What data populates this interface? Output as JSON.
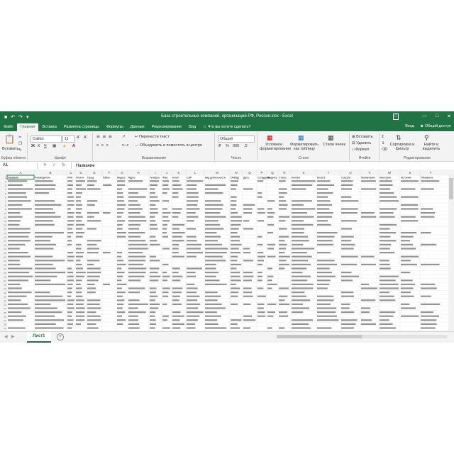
{
  "window": {
    "title": "База строительных компаний, организаций РФ, Россия.xlsx - Excel",
    "account_label": "Вход",
    "share_label": "Общий доступ",
    "tell_me": "Что вы хотите сделать?"
  },
  "tabs": [
    "Файл",
    "Главная",
    "Вставка",
    "Разметка страницы",
    "Формулы",
    "Данные",
    "Рецензирование",
    "Вид"
  ],
  "active_tab": "Главная",
  "ribbon": {
    "clipboard": {
      "paste": "Вставить",
      "label": "Буфер обмена"
    },
    "font": {
      "name": "Calibri",
      "size": "11",
      "label": "Шрифт"
    },
    "alignment": {
      "wrap": "Перенести текст",
      "merge": "Объединить и поместить в центре",
      "label": "Выравнивание"
    },
    "number": {
      "format": "Общий",
      "label": "Число"
    },
    "styles": {
      "conditional": "Условное форматирование",
      "format_table": "Форматировать как таблицу",
      "cell_styles": "Стили ячеек",
      "label": "Стили"
    },
    "cells": {
      "insert": "Вставить",
      "delete": "Удалить",
      "format": "Формат",
      "label": "Ячейки"
    },
    "editing": {
      "sort": "Сортировка и фильтр",
      "find": "Найти и выделить",
      "label": "Редактирование"
    }
  },
  "formula_bar": {
    "cell_ref": "A1",
    "value": "Название"
  },
  "columns": [
    "A",
    "B",
    "C",
    "D",
    "E",
    "F",
    "G",
    "H",
    "I",
    "J",
    "K",
    "L",
    "M",
    "N",
    "O",
    "P",
    "Q",
    "R",
    "S",
    "T",
    "U",
    "V",
    "W",
    "X",
    "Y"
  ],
  "headers": [
    "Название",
    "Руководитель",
    "ИНН",
    "Регион",
    "Город",
    "Район",
    "Индекс",
    "Адрес",
    "Телефон",
    "Факс",
    "Email",
    "Сайт",
    "Вид деятельности",
    "ОКВЭД",
    "Дата",
    "Сотрудники",
    "Выручка",
    "Статус",
    "Контакт",
    "Email 2",
    "Соцсеть",
    "Примечание",
    "Категория",
    "Источник",
    "Обновлено"
  ],
  "sheet": {
    "name": "Лист1"
  }
}
